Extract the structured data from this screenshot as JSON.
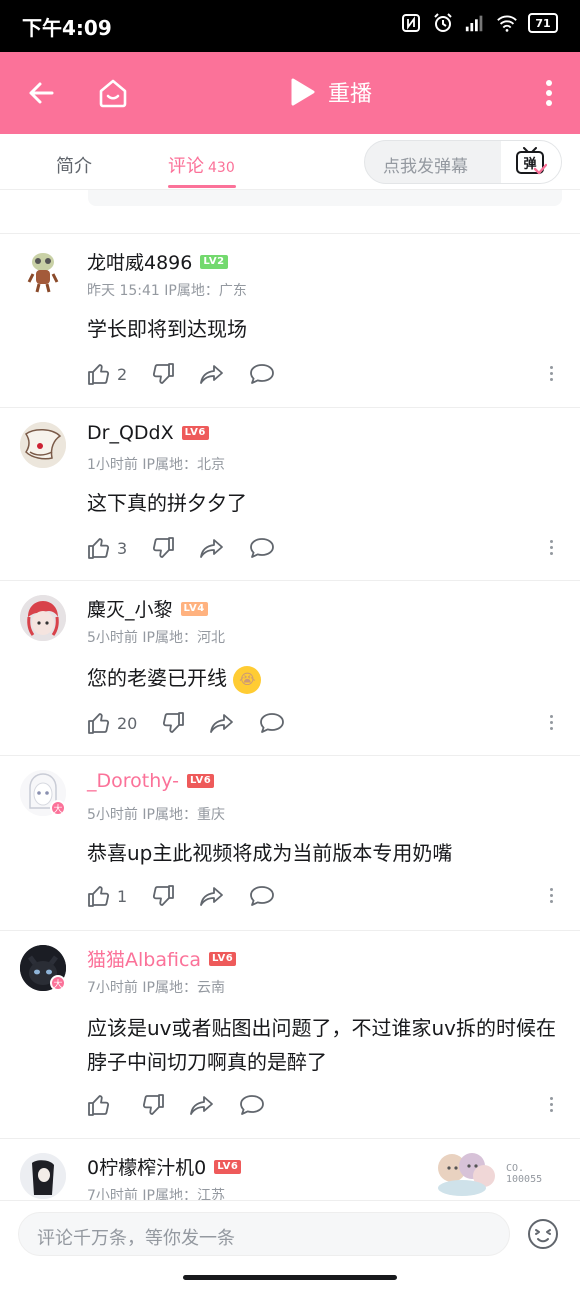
{
  "status_bar": {
    "time": "下午4:09",
    "battery": "71"
  },
  "top_bar": {
    "replay_label": "重播"
  },
  "tabs": [
    {
      "label": "简介"
    },
    {
      "label": "评论",
      "count": "430"
    }
  ],
  "danmaku": {
    "placeholder": "点我发弹幕",
    "button_label": "弹"
  },
  "comments": [
    {
      "username": "龙咁威4896",
      "level": "LV2",
      "level_color": "#73d96e",
      "time": "昨天 15:41",
      "ip": "IP属地：广东",
      "content": "学长即将到达现场",
      "likes": "2",
      "vip": false,
      "emoji": ""
    },
    {
      "username": "Dr_QDdX",
      "level": "LV6",
      "level_color": "#ee5a5a",
      "time": "1小时前",
      "ip": "IP属地：北京",
      "content": "这下真的拼夕夕了",
      "likes": "3",
      "vip": false,
      "emoji": ""
    },
    {
      "username": "麋灭_小黎",
      "level": "LV4",
      "level_color": "#ffb27f",
      "time": "5小时前",
      "ip": "IP属地：河北",
      "content": "您的老婆已开线",
      "likes": "20",
      "vip": false,
      "emoji": "😭"
    },
    {
      "username": "_Dorothy-",
      "level": "LV6",
      "level_color": "#ee5a5a",
      "time": "5小时前",
      "ip": "IP属地：重庆",
      "content": "恭喜up主此视频将成为当前版本专用奶嘴",
      "likes": "1",
      "vip": true,
      "emoji": ""
    },
    {
      "username": "猫猫Albafica",
      "level": "LV6",
      "level_color": "#ee5a5a",
      "time": "7小时前",
      "ip": "IP属地：云南",
      "content": "应该是uv或者贴图出问题了，不过谁家uv拆的时候在脖子中间切刀啊真的是醉了",
      "likes": "",
      "vip": true,
      "emoji": ""
    },
    {
      "username": "0柠檬榨汁机0",
      "level": "LV6",
      "level_color": "#ee5a5a",
      "time": "7小时前",
      "ip": "IP属地：江苏",
      "content": "",
      "likes": "",
      "vip": false,
      "emoji": ""
    }
  ],
  "avatar_badge": "大",
  "watermark": {
    "line1": "CO.",
    "line2": "100055"
  },
  "bottom_bar": {
    "placeholder": "评论千万条，等你发一条"
  },
  "colors": {
    "accent": "#fb7299",
    "text": "#18191c",
    "muted": "#9499a0"
  }
}
